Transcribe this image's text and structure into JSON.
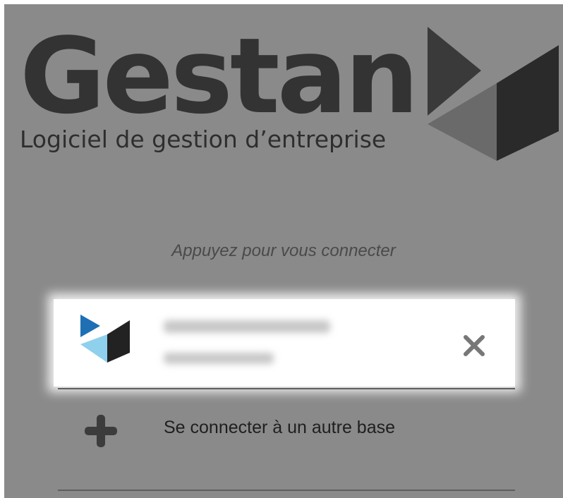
{
  "logo": {
    "word": "Gestan",
    "tagline": "Logiciel de gestion d’entreprise"
  },
  "hint": "Appuyez pour vous connecter",
  "account_card": {
    "icon": "gestan-logo-icon",
    "remove_icon": "close-icon"
  },
  "add_base": {
    "icon": "plus-icon",
    "label": "Se connecter à un autre base"
  },
  "colors": {
    "overlay_bg": "#8a8a8a",
    "logo_dark": "#333333",
    "accent_blue": "#1e6fb4",
    "accent_light_blue": "#8fd0ec"
  }
}
